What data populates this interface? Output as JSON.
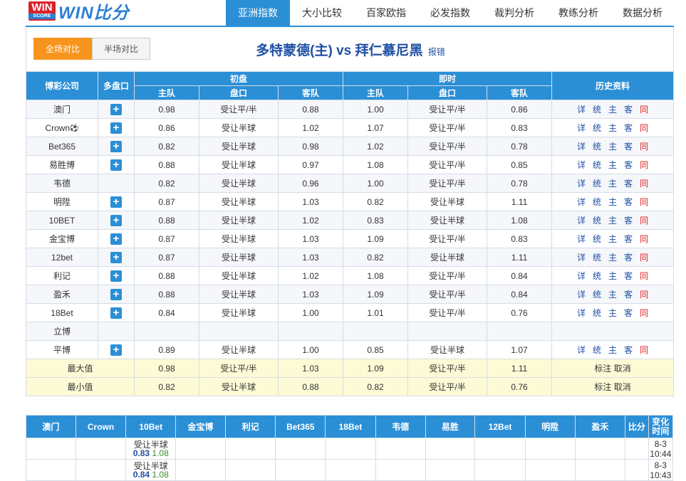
{
  "logo": {
    "badge_top": "WIN",
    "badge_bottom": "SCORE",
    "text": "WIN比分"
  },
  "nav": [
    {
      "label": "亚洲指数"
    },
    {
      "label": "大小比较"
    },
    {
      "label": "百家欧指"
    },
    {
      "label": "必发指数"
    },
    {
      "label": "裁判分析"
    },
    {
      "label": "教练分析"
    },
    {
      "label": "数据分析"
    }
  ],
  "tabs": {
    "full": "全场对比",
    "half": "半场对比"
  },
  "match": {
    "teams": "多特蒙德(主) vs 拜仁慕尼黑",
    "report": "报错"
  },
  "table_header": {
    "company": "博彩公司",
    "multi": "多盘口",
    "initial": "初盘",
    "live": "即时",
    "history": "历史资料",
    "home": "主队",
    "handicap": "盘口",
    "away": "客队"
  },
  "links": {
    "detail": "详",
    "total": "统",
    "home": "主",
    "away": "客",
    "same": "同"
  },
  "rows": [
    {
      "company": "澳门",
      "plus": true,
      "ih": "0.98",
      "ip": "受让平/半",
      "ia": "0.88",
      "lh": "1.00",
      "lp": "受让平/半",
      "la": "0.86",
      "links": true
    },
    {
      "company": "Crown",
      "ball": true,
      "plus": true,
      "ih": "0.86",
      "ip": "受让半球",
      "ia": "1.02",
      "lh": "1.07",
      "lp": "受让平/半",
      "la": "0.83",
      "links": true
    },
    {
      "company": "Bet365",
      "plus": true,
      "ih": "0.82",
      "ip": "受让半球",
      "ia": "0.98",
      "lh": "1.02",
      "lp": "受让平/半",
      "la": "0.78",
      "links": true
    },
    {
      "company": "易胜博",
      "plus": true,
      "ih": "0.88",
      "ip": "受让半球",
      "ia": "0.97",
      "lh": "1.08",
      "lp": "受让平/半",
      "la": "0.85",
      "links": true
    },
    {
      "company": "韦德",
      "plus": false,
      "ih": "0.82",
      "ip": "受让半球",
      "ia": "0.96",
      "lh": "1.00",
      "lp": "受让平/半",
      "la": "0.78",
      "links": true
    },
    {
      "company": "明陞",
      "plus": true,
      "ih": "0.87",
      "ip": "受让半球",
      "ia": "1.03",
      "lh": "0.82",
      "lp": "受让半球",
      "la": "1.11",
      "links": true
    },
    {
      "company": "10BET",
      "plus": true,
      "ih": "0.88",
      "ip": "受让半球",
      "ia": "1.02",
      "lh": "0.83",
      "lp": "受让半球",
      "la": "1.08",
      "links": true
    },
    {
      "company": "金宝博",
      "plus": true,
      "ih": "0.87",
      "ip": "受让半球",
      "ia": "1.03",
      "lh": "1.09",
      "lp": "受让平/半",
      "la": "0.83",
      "links": true
    },
    {
      "company": "12bet",
      "plus": true,
      "ih": "0.87",
      "ip": "受让半球",
      "ia": "1.03",
      "lh": "0.82",
      "lp": "受让半球",
      "la": "1.11",
      "links": true
    },
    {
      "company": "利记",
      "plus": true,
      "ih": "0.88",
      "ip": "受让半球",
      "ia": "1.02",
      "lh": "1.08",
      "lp": "受让平/半",
      "la": "0.84",
      "links": true
    },
    {
      "company": "盈禾",
      "plus": true,
      "ih": "0.88",
      "ip": "受让半球",
      "ia": "1.03",
      "lh": "1.09",
      "lp": "受让平/半",
      "la": "0.84",
      "links": true
    },
    {
      "company": "18Bet",
      "plus": true,
      "ih": "0.84",
      "ip": "受让半球",
      "ia": "1.00",
      "lh": "1.01",
      "lp": "受让平/半",
      "la": "0.76",
      "links": true
    },
    {
      "company": "立博",
      "plus": false,
      "ih": "",
      "ip": "",
      "ia": "",
      "lh": "",
      "lp": "",
      "la": "",
      "links": false
    },
    {
      "company": "平博",
      "plus": true,
      "ih": "0.89",
      "ip": "受让半球",
      "ia": "1.00",
      "lh": "0.85",
      "lp": "受让半球",
      "la": "1.07",
      "links": true
    }
  ],
  "summary": [
    {
      "label": "最大值",
      "ih": "0.98",
      "ip": "受让平/半",
      "ia": "1.03",
      "lh": "1.09",
      "lp": "受让平/半",
      "la": "1.11"
    },
    {
      "label": "最小值",
      "ih": "0.82",
      "ip": "受让半球",
      "ia": "0.88",
      "lh": "0.82",
      "lp": "受让平/半",
      "la": "0.76"
    }
  ],
  "summary_actions": {
    "mark": "标注",
    "cancel": "取消"
  },
  "history_header": [
    "澳门",
    "Crown",
    "10Bet",
    "金宝博",
    "利记",
    "Bet365",
    "18Bet",
    "韦德",
    "易胜",
    "12Bet",
    "明陞",
    "盈禾",
    "比分",
    "变化时间"
  ],
  "history_rows": [
    {
      "line": "受让半球",
      "home": "0.83",
      "away": "1.08",
      "time": "8-3",
      "time2": "10:44"
    },
    {
      "line": "受让半球",
      "home": "0.84",
      "away": "1.08",
      "time": "8-3",
      "time2": "10:43"
    }
  ],
  "colors": {
    "accent": "#2b8fd6",
    "active_tab": "#f7941d",
    "link": "#1f4fa3",
    "red": "#e02020",
    "summary_bg": "#fdfbd6"
  }
}
